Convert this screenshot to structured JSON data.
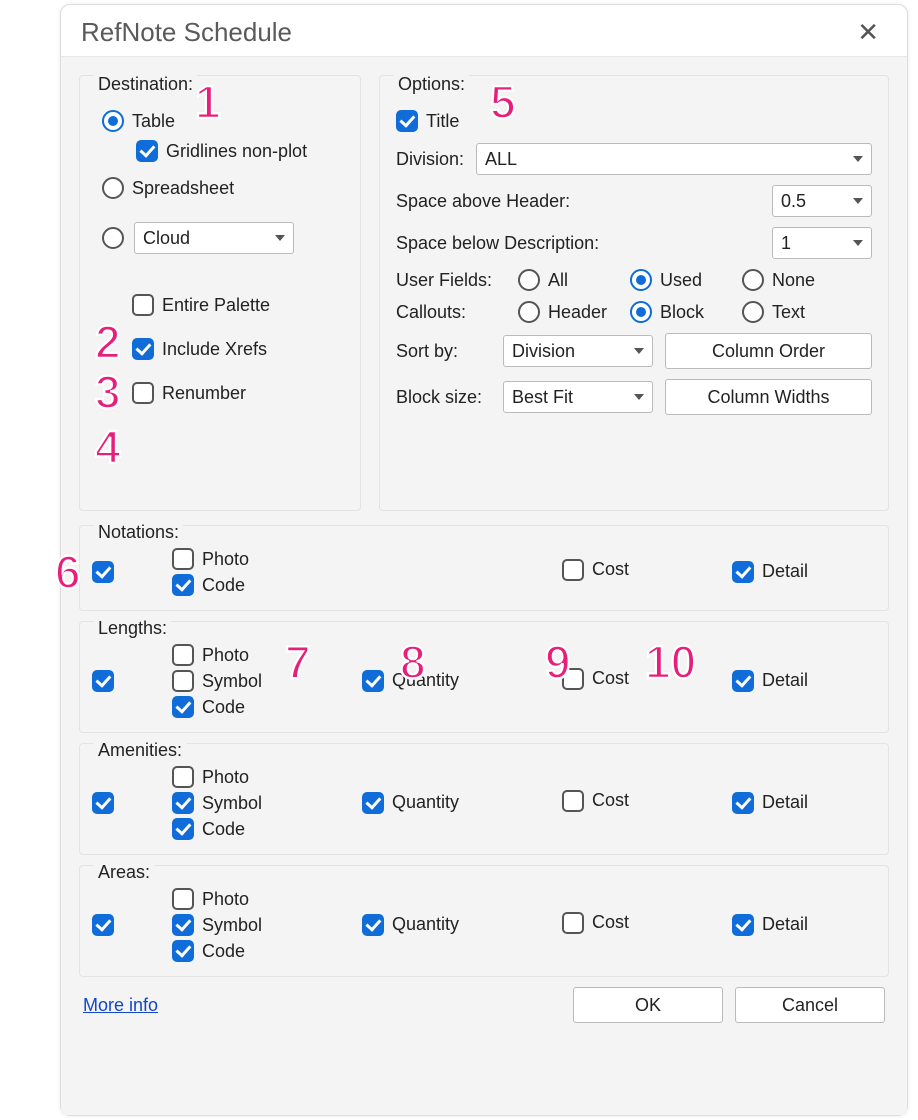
{
  "title": "RefNote Schedule",
  "destination": {
    "legend": "Destination:",
    "table_label": "Table",
    "gridlines_label": "Gridlines non-plot",
    "spreadsheet_label": "Spreadsheet",
    "cloud_value": "Cloud",
    "selected": "table",
    "gridlines_checked": true,
    "entire_palette_label": "Entire Palette",
    "entire_palette_checked": false,
    "include_xrefs_label": "Include Xrefs",
    "include_xrefs_checked": true,
    "renumber_label": "Renumber",
    "renumber_checked": false
  },
  "options": {
    "legend": "Options:",
    "title_label": "Title",
    "title_checked": true,
    "division_label": "Division:",
    "division_value": "ALL",
    "space_above_label": "Space above Header:",
    "space_above_value": "0.5",
    "space_below_label": "Space below Description:",
    "space_below_value": "1",
    "user_fields_label": "User Fields:",
    "user_fields": {
      "all": "All",
      "used": "Used",
      "none": "None",
      "selected": "used"
    },
    "callouts_label": "Callouts:",
    "callouts": {
      "header": "Header",
      "block": "Block",
      "text": "Text",
      "selected": "block"
    },
    "sort_by_label": "Sort by:",
    "sort_by_value": "Division",
    "column_order_btn": "Column Order",
    "block_size_label": "Block size:",
    "block_size_value": "Best Fit",
    "column_widths_btn": "Column Widths"
  },
  "common": {
    "photo": "Photo",
    "symbol": "Symbol",
    "code": "Code",
    "quantity": "Quantity",
    "cost": "Cost",
    "detail": "Detail"
  },
  "categories": {
    "notations": {
      "legend": "Notations:",
      "enabled": true,
      "photo": false,
      "code": true,
      "cost": false,
      "detail": true,
      "has_symbol": false,
      "has_quantity": false
    },
    "lengths": {
      "legend": "Lengths:",
      "enabled": true,
      "photo": false,
      "symbol": false,
      "code": true,
      "quantity": true,
      "cost": false,
      "detail": true,
      "has_symbol": true,
      "has_quantity": true
    },
    "amenities": {
      "legend": "Amenities:",
      "enabled": true,
      "photo": false,
      "symbol": true,
      "code": true,
      "quantity": true,
      "cost": false,
      "detail": true,
      "has_symbol": true,
      "has_quantity": true
    },
    "areas": {
      "legend": "Areas:",
      "enabled": true,
      "photo": false,
      "symbol": true,
      "code": true,
      "quantity": true,
      "cost": false,
      "detail": true,
      "has_symbol": true,
      "has_quantity": true
    }
  },
  "footer": {
    "more_info": "More info",
    "ok": "OK",
    "cancel": "Cancel"
  },
  "annotations": [
    "1",
    "2",
    "3",
    "4",
    "5",
    "6",
    "7",
    "8",
    "9",
    "10"
  ]
}
